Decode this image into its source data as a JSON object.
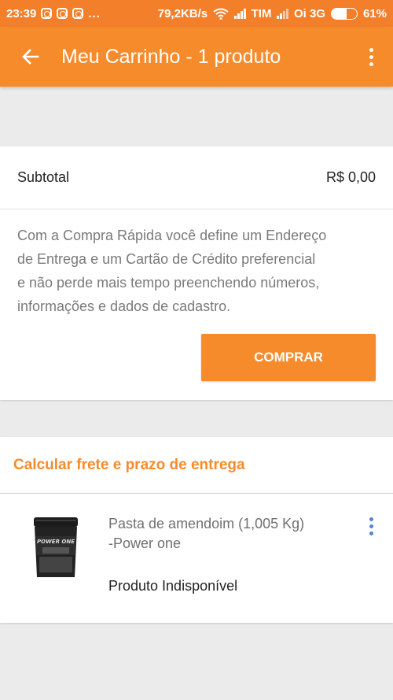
{
  "status_bar": {
    "time": "23:39",
    "more": "...",
    "speed": "79,2KB/s",
    "carrier1": "TIM",
    "carrier2": "Oi 3G",
    "battery": "61%",
    "battery_level": 0.61,
    "icons": [
      "instagram-icon",
      "instagram-icon",
      "instagram-icon",
      "wifi-icon",
      "signal-icon",
      "signal-icon",
      "battery-icon"
    ]
  },
  "app_bar": {
    "title": "Meu Carrinho - 1 produto",
    "back_icon": "arrow-left-icon",
    "menu_icon": "more-vertical-icon"
  },
  "summary": {
    "subtotal_label": "Subtotal",
    "subtotal_value": "R$ 0,00",
    "info_lines": [
      "Com a Compra Rápida você define um Endereço",
      "de Entrega e um Cartão de Crédito preferencial",
      "e não perde mais tempo preenchendo números,",
      "informações e dados de cadastro."
    ],
    "buy_label": "COMPRAR"
  },
  "shipping": {
    "label": "Calcular frete e prazo de entrega"
  },
  "product": {
    "name_line1": "Pasta de amendoim (1,005 Kg)",
    "name_line2": "-Power one",
    "status": "Produto Indisponível",
    "image_brand": "POWER ONE"
  },
  "colors": {
    "status_bar": "#f37f2a",
    "accent": "#f68b2b",
    "background": "#ebebeb",
    "menu_dots": "#4f86d6"
  }
}
